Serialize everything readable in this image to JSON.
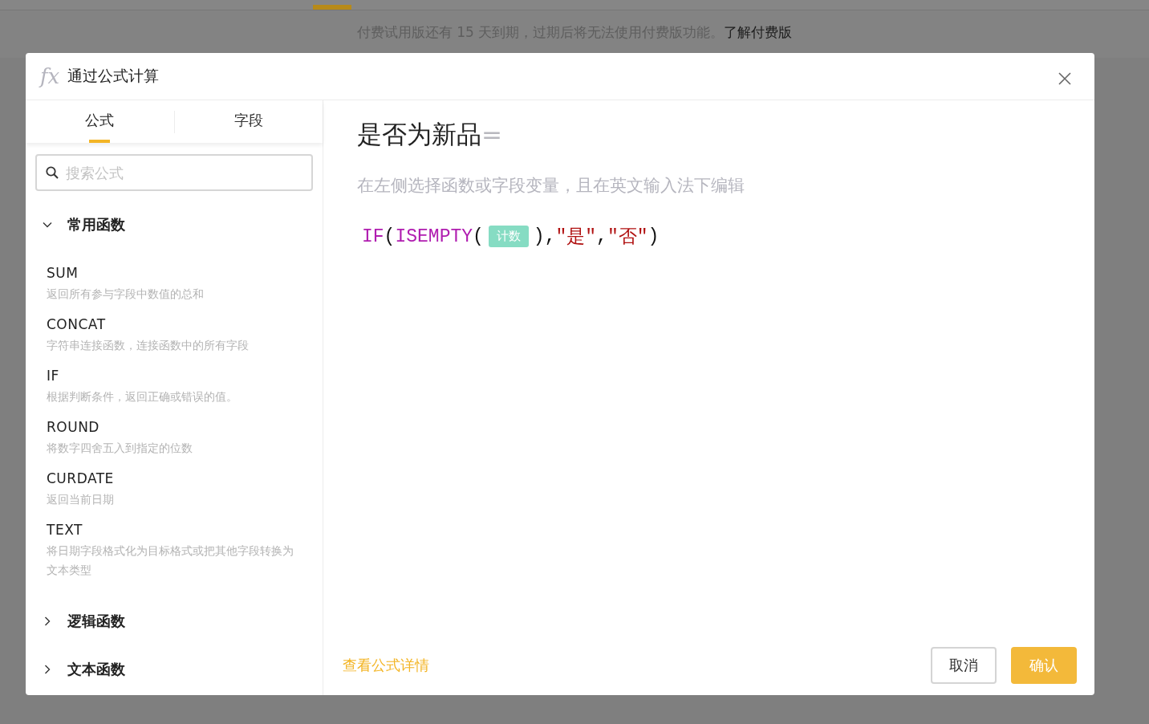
{
  "notice": {
    "text": "付费试用版还有 15 天到期，过期后将无法使用付费版功能。",
    "link": "了解付费版"
  },
  "dialog": {
    "icon_text": "fx",
    "title": "通过公式计算"
  },
  "tabs": [
    {
      "label": "公式",
      "selected": true
    },
    {
      "label": "字段",
      "selected": false
    }
  ],
  "search": {
    "placeholder": "搜索公式"
  },
  "groups": [
    {
      "label": "常用函数",
      "expanded": true,
      "children": [
        {
          "name": "SUM",
          "description": "返回所有参与字段中数值的总和"
        },
        {
          "name": "CONCAT",
          "description": "字符串连接函数，连接函数中的所有字段"
        },
        {
          "name": "IF",
          "description": "根据判断条件，返回正确或错误的值。"
        },
        {
          "name": "ROUND",
          "description": "将数字四舍五入到指定的位数"
        },
        {
          "name": "CURDATE",
          "description": "返回当前日期"
        },
        {
          "name": "TEXT",
          "description": "将日期字段格式化为目标格式或把其他字段转换为文本类型"
        }
      ]
    },
    {
      "label": "逻辑函数",
      "expanded": false
    },
    {
      "label": "文本函数",
      "expanded": false
    }
  ],
  "editor": {
    "field_name": "是否为新品",
    "equals": "=",
    "hint": "在左侧选择函数或字段变量，且在英文输入法下编辑",
    "formula": [
      {
        "kind": "function",
        "text": "IF"
      },
      {
        "kind": "punct",
        "text": "("
      },
      {
        "kind": "function",
        "text": "ISEMPTY"
      },
      {
        "kind": "punct",
        "text": "("
      },
      {
        "kind": "field",
        "text": "计数"
      },
      {
        "kind": "punct",
        "text": "),"
      },
      {
        "kind": "string",
        "text": "\"是\""
      },
      {
        "kind": "punct",
        "text": ","
      },
      {
        "kind": "string",
        "text": "\"否\""
      },
      {
        "kind": "punct",
        "text": ")"
      }
    ]
  },
  "footer": {
    "link": "查看公式详情",
    "buttons": [
      {
        "label": "取消",
        "kind": "secondary"
      },
      {
        "label": "确认",
        "kind": "primary"
      }
    ]
  }
}
